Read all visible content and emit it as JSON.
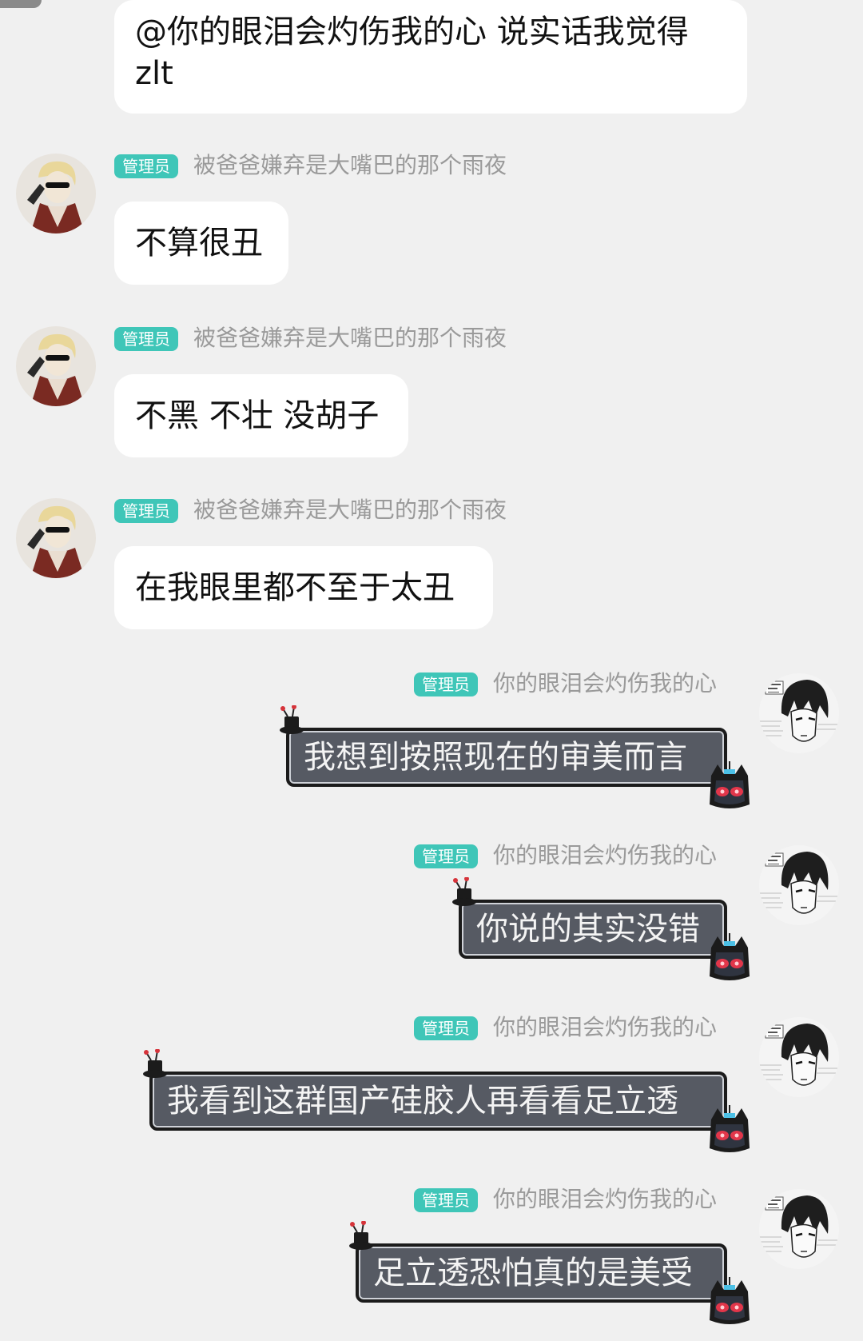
{
  "top_message": {
    "line1": "@你的眼泪会灼伤我的心 说实话我觉得",
    "line2": "zlt"
  },
  "left_messages": [
    {
      "badge": "管理员",
      "nick": "被爸爸嫌弃是大嘴巴的那个雨夜",
      "text": "不算很丑"
    },
    {
      "badge": "管理员",
      "nick": "被爸爸嫌弃是大嘴巴的那个雨夜",
      "text": "不黑 不壮 没胡子"
    },
    {
      "badge": "管理员",
      "nick": "被爸爸嫌弃是大嘴巴的那个雨夜",
      "text": "在我眼里都不至于太丑"
    }
  ],
  "right_messages": [
    {
      "badge": "管理员",
      "nick": "你的眼泪会灼伤我的心",
      "text": "我想到按照现在的审美而言"
    },
    {
      "badge": "管理员",
      "nick": "你的眼泪会灼伤我的心",
      "text": "你说的其实没错"
    },
    {
      "badge": "管理员",
      "nick": "你的眼泪会灼伤我的心",
      "text": "我看到这群国产硅胶人再看看足立透"
    },
    {
      "badge": "管理员",
      "nick": "你的眼泪会灼伤我的心",
      "text": "足立透恐怕真的是美受"
    }
  ],
  "colors": {
    "background": "#f0f0f0",
    "badge": "#3fc6b8",
    "nickname": "#9a9a9a",
    "dark_bubble": "#565a63"
  },
  "icons": {
    "left_avatar": "blonde-sunglasses-avatar",
    "right_avatar": "manga-dark-hair-avatar",
    "bubble_decoration_top": "antenna-top-hat-icon",
    "bubble_decoration_bottom": "robot-cat-face-icon"
  }
}
